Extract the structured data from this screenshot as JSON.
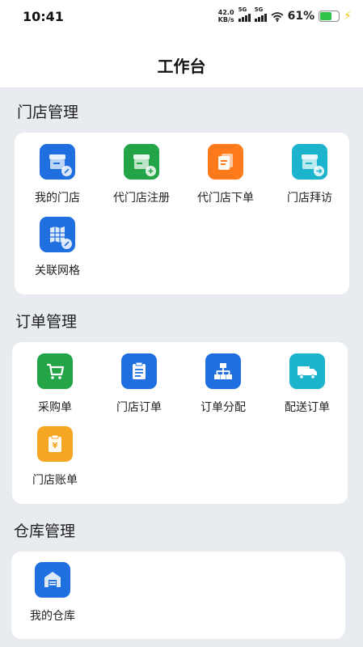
{
  "status_bar": {
    "time": "10:41",
    "speed_value": "42.0",
    "speed_unit": "KB/s",
    "sim1": "5G",
    "sim2": "5G",
    "battery_pct": "61%"
  },
  "page": {
    "title": "工作台"
  },
  "colors": {
    "blue": "#1f6fe0",
    "green": "#22a447",
    "orange": "#ff7a1a",
    "cyan": "#1bb4cc",
    "amber": "#f5a623",
    "background": "#e8ebf0"
  },
  "sections": [
    {
      "title": "门店管理",
      "items": [
        {
          "label": "我的门店",
          "icon": "store-icon",
          "color": "blue"
        },
        {
          "label": "代门店注册",
          "icon": "store-add-icon",
          "color": "green"
        },
        {
          "label": "代门店下单",
          "icon": "documents-icon",
          "color": "orange"
        },
        {
          "label": "门店拜访",
          "icon": "store-visit-icon",
          "color": "cyan"
        },
        {
          "label": "关联网格",
          "icon": "grid-map-icon",
          "color": "blue"
        }
      ]
    },
    {
      "title": "订单管理",
      "items": [
        {
          "label": "采购单",
          "icon": "shopping-cart-icon",
          "color": "green"
        },
        {
          "label": "门店订单",
          "icon": "clipboard-icon",
          "color": "blue"
        },
        {
          "label": "订单分配",
          "icon": "hierarchy-icon",
          "color": "blue"
        },
        {
          "label": "配送订单",
          "icon": "delivery-truck-icon",
          "color": "cyan"
        },
        {
          "label": "门店账单",
          "icon": "bill-yuan-icon",
          "color": "amber"
        }
      ]
    },
    {
      "title": "仓库管理",
      "items": [
        {
          "label": "我的仓库",
          "icon": "warehouse-icon",
          "color": "blue"
        }
      ]
    }
  ]
}
